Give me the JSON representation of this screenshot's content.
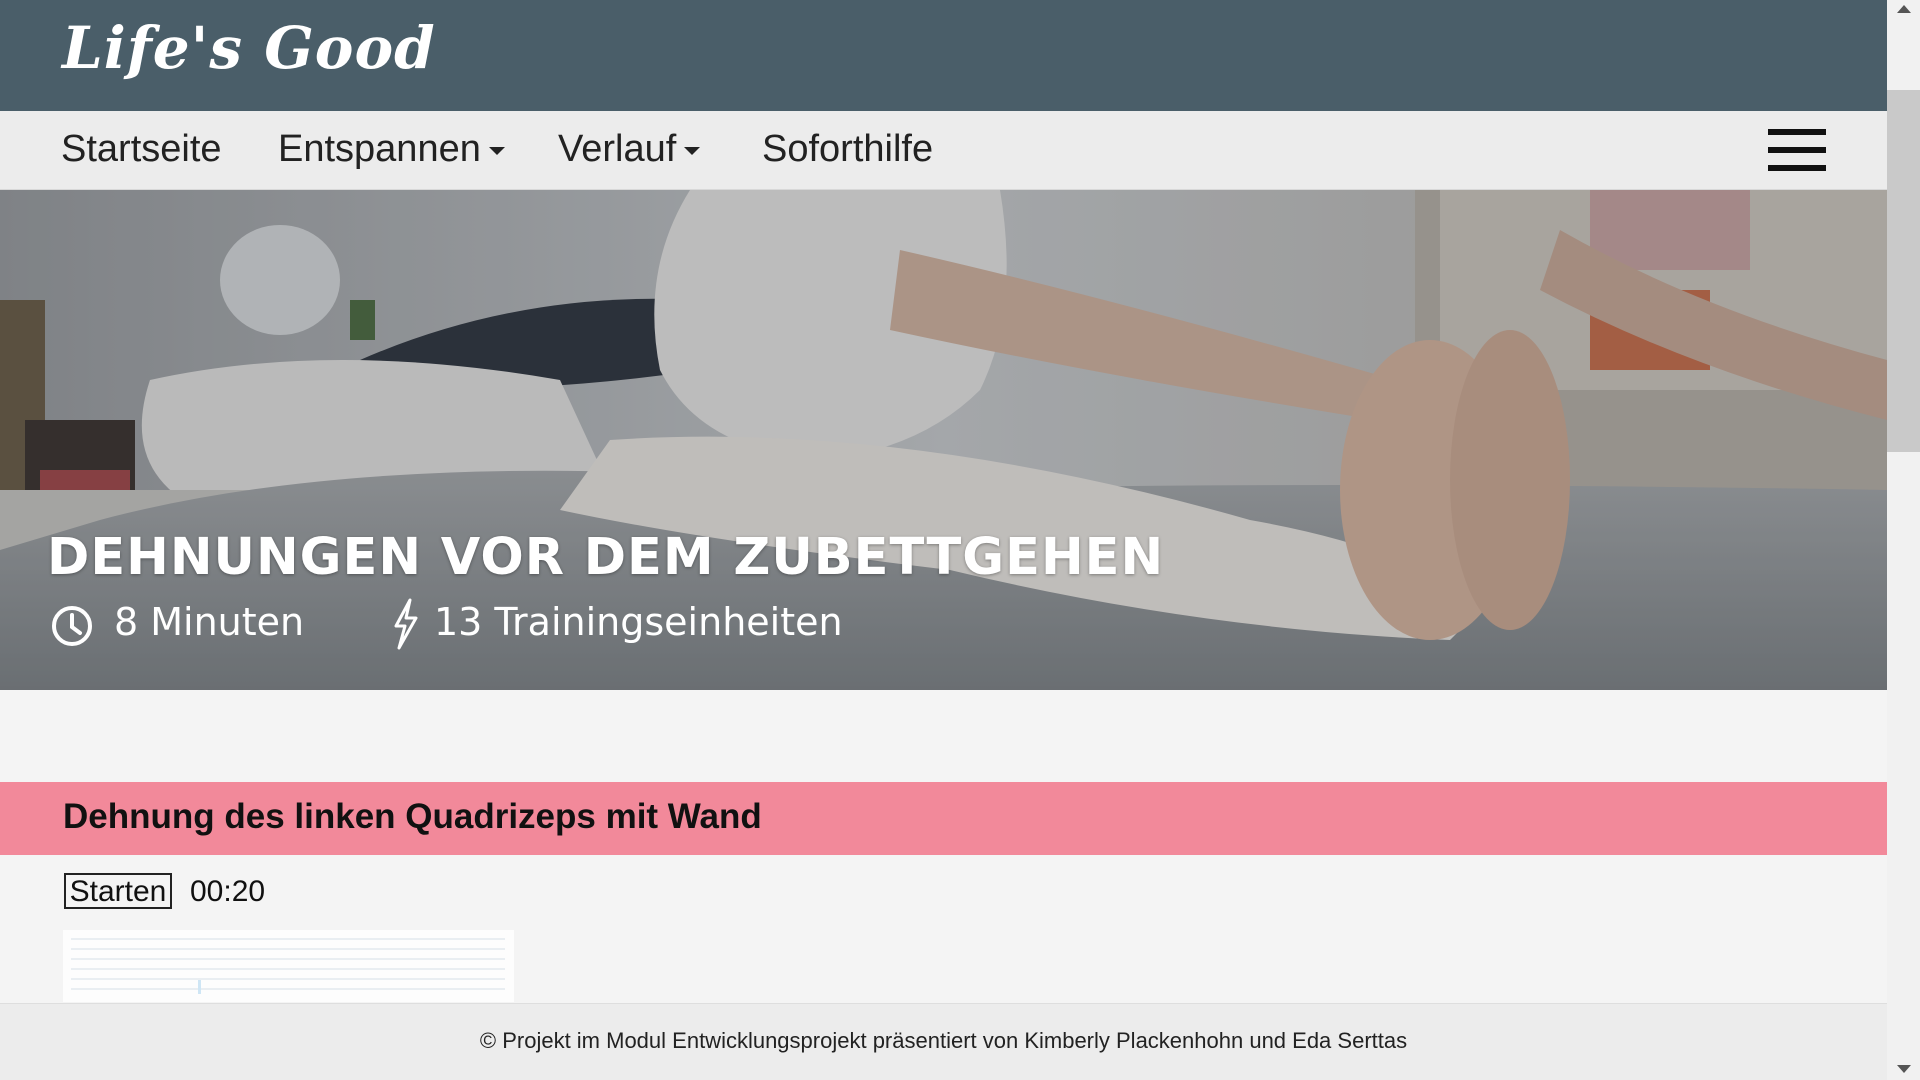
{
  "header": {
    "logo": "Life's Good"
  },
  "nav": {
    "items": [
      {
        "label": "Startseite",
        "has_dropdown": false
      },
      {
        "label": "Entspannen",
        "has_dropdown": true
      },
      {
        "label": "Verlauf",
        "has_dropdown": true
      },
      {
        "label": "Soforthilfe",
        "has_dropdown": false
      }
    ],
    "menu_icon": "hamburger-menu-icon"
  },
  "hero": {
    "title": "DEHNUNGEN VOR DEM ZUBETTGEHEN",
    "duration": "8 Minuten",
    "duration_icon": "clock-icon",
    "units": "13 Trainingseinheiten",
    "units_icon": "lightning-icon"
  },
  "exercise": {
    "title": "Dehnung des linken Quadrizeps mit Wand",
    "start_label": "Starten",
    "timer": "00:20"
  },
  "footer": {
    "text": "© Projekt im Modul Entwicklungsprojekt präsentiert von Kimberly Plackenhohn und Eda Serttas"
  },
  "colors": {
    "header_bg": "#4a5e69",
    "nav_bg": "#ececec",
    "exercise_header_bg": "#f2899a",
    "page_bg": "#f4f4f4"
  }
}
